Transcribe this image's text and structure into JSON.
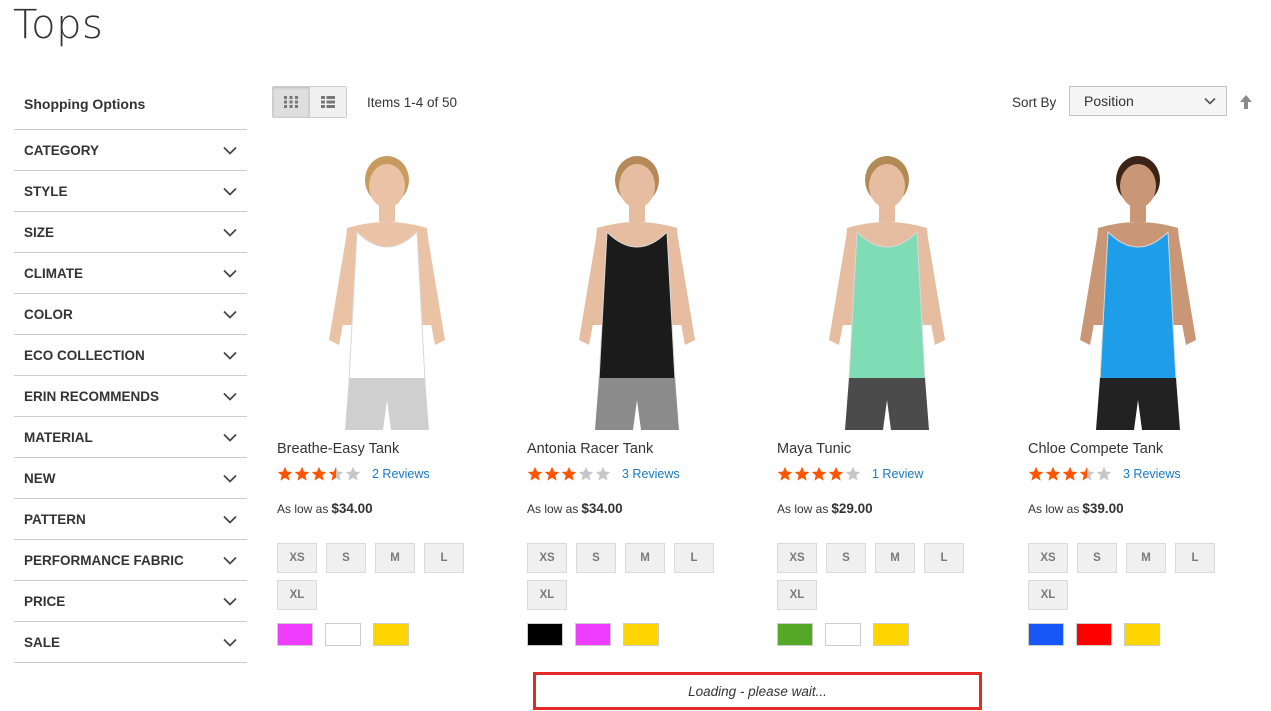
{
  "page": {
    "title": "Tops"
  },
  "sidebar": {
    "title": "Shopping Options",
    "filters": [
      {
        "label": "CATEGORY"
      },
      {
        "label": "STYLE"
      },
      {
        "label": "SIZE"
      },
      {
        "label": "CLIMATE"
      },
      {
        "label": "COLOR"
      },
      {
        "label": "ECO COLLECTION"
      },
      {
        "label": "ERIN RECOMMENDS"
      },
      {
        "label": "MATERIAL"
      },
      {
        "label": "NEW"
      },
      {
        "label": "PATTERN"
      },
      {
        "label": "PERFORMANCE FABRIC"
      },
      {
        "label": "PRICE"
      },
      {
        "label": "SALE"
      }
    ]
  },
  "toolbar": {
    "amount": "Items 1-4 of 50",
    "sort_label": "Sort By",
    "sort_value": "Position",
    "view_mode": "grid"
  },
  "products": [
    {
      "name": "Breathe-Easy Tank",
      "rating_pct": 70,
      "reviews": "2 Reviews",
      "price_prefix": "As low as",
      "price": "$34.00",
      "sizes": [
        "XS",
        "S",
        "M",
        "L",
        "XL"
      ],
      "colors": [
        "#ef3dff",
        "#ffffff",
        "#ffd500"
      ],
      "top_color": "#ffffff",
      "bottom_color": "#cfcfcf",
      "skin": "#eac3a6",
      "hair": "#c79a5e"
    },
    {
      "name": "Antonia Racer Tank",
      "rating_pct": 60,
      "reviews": "3 Reviews",
      "price_prefix": "As low as",
      "price": "$34.00",
      "sizes": [
        "XS",
        "S",
        "M",
        "L",
        "XL"
      ],
      "colors": [
        "#000000",
        "#ef3dff",
        "#ffd500"
      ],
      "top_color": "#1b1b1b",
      "bottom_color": "#8b8b8b",
      "skin": "#e6bda0",
      "hair": "#b58a58"
    },
    {
      "name": "Maya Tunic",
      "rating_pct": 80,
      "reviews": "1 Review",
      "price_prefix": "As low as",
      "price": "$29.00",
      "sizes": [
        "XS",
        "S",
        "M",
        "L",
        "XL"
      ],
      "colors": [
        "#53a828",
        "#ffffff",
        "#ffd500"
      ],
      "top_color": "#7fdcb4",
      "bottom_color": "#4b4b4b",
      "skin": "#e6bda0",
      "hair": "#b28a55"
    },
    {
      "name": "Chloe Compete Tank",
      "rating_pct": 70,
      "reviews": "3 Reviews",
      "price_prefix": "As low as",
      "price": "$39.00",
      "sizes": [
        "XS",
        "S",
        "M",
        "L",
        "XL"
      ],
      "colors": [
        "#1857f7",
        "#ff0000",
        "#ffd500"
      ],
      "top_color": "#1e9ee8",
      "bottom_color": "#222222",
      "skin": "#c99775",
      "hair": "#3b2417"
    }
  ],
  "loading": {
    "text": "Loading - please wait..."
  },
  "colors": {
    "star": "#ff5501",
    "star_empty": "#c7c7c7",
    "link": "#1979c3",
    "highlight_border": "#e02b27"
  }
}
